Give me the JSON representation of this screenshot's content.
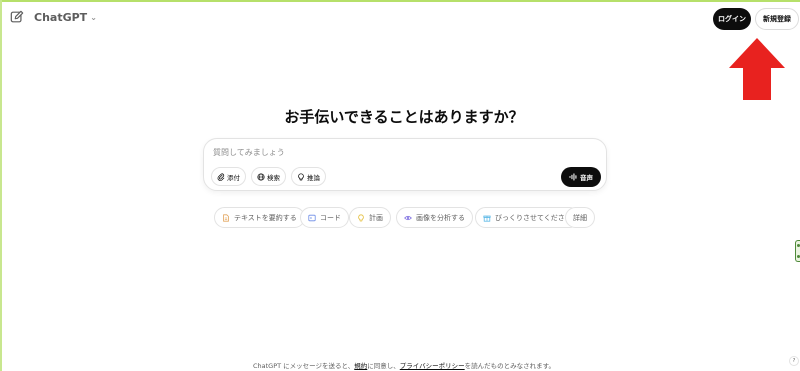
{
  "header": {
    "model_name": "ChatGPT",
    "login_label": "ログイン",
    "signup_label": "新規登録"
  },
  "main": {
    "heading": "お手伝いできることはありますか？",
    "composer": {
      "placeholder": "質問してみましょう",
      "tools": [
        {
          "label": "添付",
          "icon": "paperclip-icon"
        },
        {
          "label": "検索",
          "icon": "globe-icon"
        },
        {
          "label": "推論",
          "icon": "lightbulb-icon"
        }
      ],
      "voice_label": "音声"
    },
    "suggestions": [
      {
        "label": "テキストを要約する",
        "icon": "document-icon",
        "color": "#e2a35a"
      },
      {
        "label": "コード",
        "icon": "code-icon",
        "color": "#6b8be6"
      },
      {
        "label": "計画",
        "icon": "lightbulb-icon",
        "color": "#e6c34a"
      },
      {
        "label": "画像を分析する",
        "icon": "eye-icon",
        "color": "#7a6be0"
      },
      {
        "label": "びっくりさせてください",
        "icon": "gift-icon",
        "color": "#5bb8e6"
      },
      {
        "label": "詳細",
        "icon": "",
        "color": ""
      }
    ]
  },
  "footer": {
    "prefix": "ChatGPT にメッセージを送ると、",
    "terms_link": "規約",
    "middle": "に同意し、",
    "privacy_link": "プライバシーポリシー",
    "suffix": "を読んだものとみなされます。",
    "help_label": "?"
  },
  "colors": {
    "accent_dark": "#0d0d0d",
    "arrow_red": "#e8221f",
    "frame_green": "#b6e06a"
  }
}
